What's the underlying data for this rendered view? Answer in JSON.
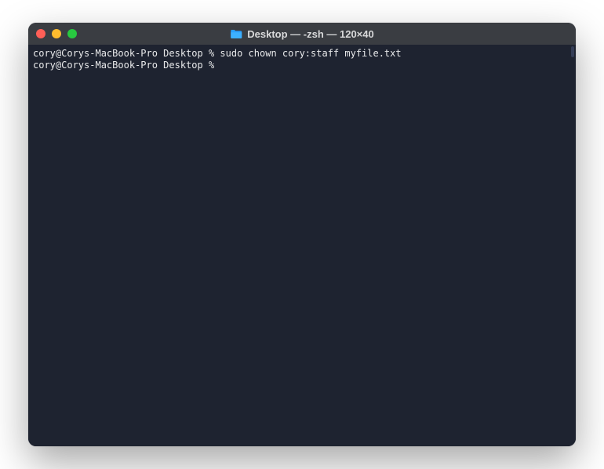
{
  "titlebar": {
    "title": "Desktop — -zsh — 120×40",
    "icon_name": "folder-icon"
  },
  "traffic_lights": {
    "close": "close",
    "minimize": "minimize",
    "maximize": "maximize"
  },
  "terminal": {
    "lines": [
      {
        "prompt": "cory@Corys-MacBook-Pro Desktop % ",
        "command": "sudo chown cory:staff myfile.txt"
      },
      {
        "prompt": "cory@Corys-MacBook-Pro Desktop % ",
        "command": ""
      }
    ]
  },
  "colors": {
    "terminal_bg": "#1e2330",
    "titlebar_bg": "#3a3d42",
    "text": "#e8e9ea",
    "close": "#ff5f57",
    "minimize": "#febc2e",
    "maximize": "#28c840",
    "folder": "#2aa0ff"
  }
}
